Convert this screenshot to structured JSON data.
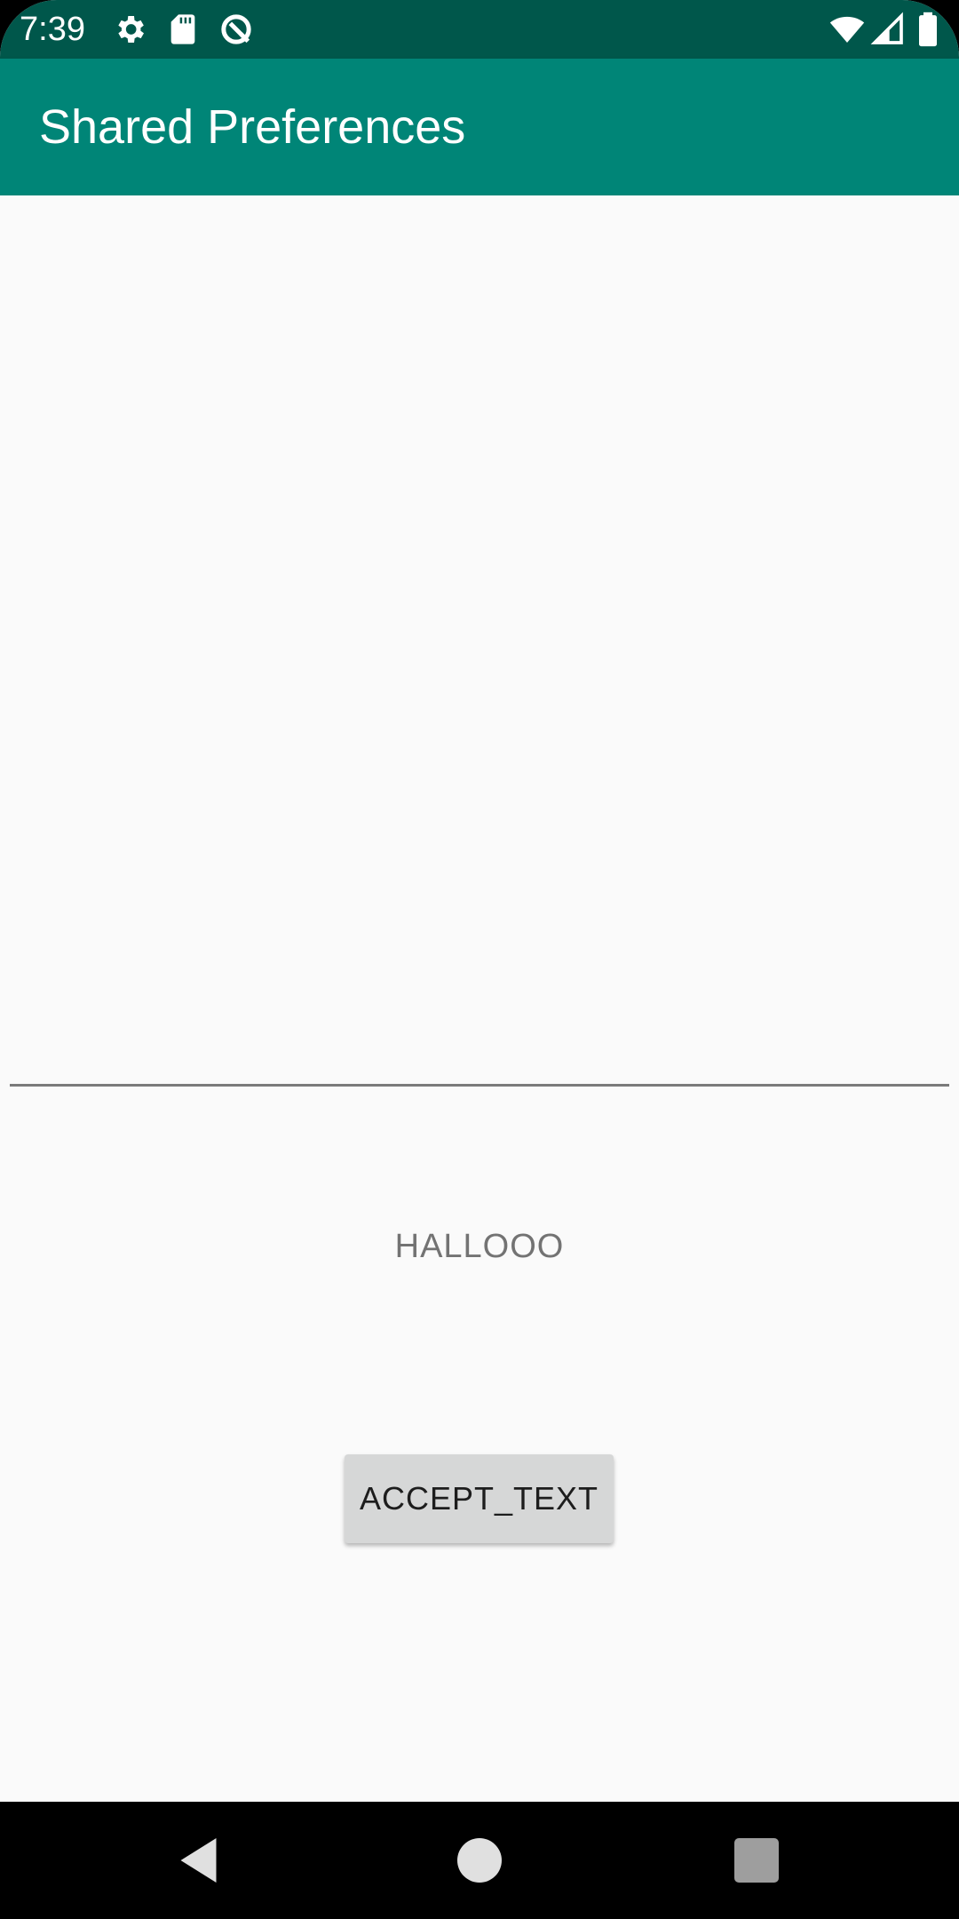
{
  "status_bar": {
    "time": "7:39",
    "left_icons": [
      "gear-icon",
      "sd-card-icon",
      "no-entry-icon"
    ],
    "right_icons": [
      "wifi-icon",
      "cellular-signal-icon",
      "battery-icon"
    ]
  },
  "app_bar": {
    "title": "Shared Preferences",
    "color": "#008577",
    "status_color": "#00574b"
  },
  "main": {
    "input_value": "",
    "display_text": "HALLOOO",
    "button_label": "ACCEPT_TEXT"
  },
  "nav_bar": {
    "icons": [
      "back-icon",
      "home-icon",
      "recents-icon"
    ]
  }
}
